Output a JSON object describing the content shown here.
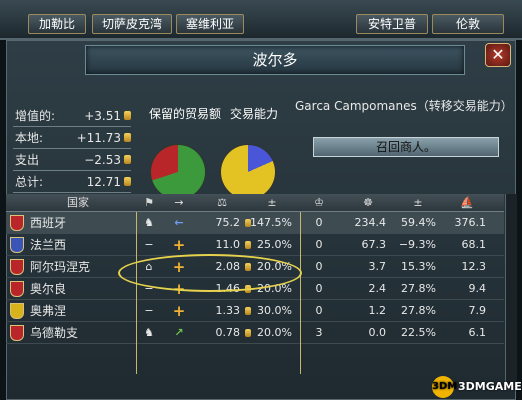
{
  "top_tabs": {
    "left": [
      "加勒比",
      "切萨皮克湾",
      "塞维利亚"
    ],
    "right": [
      "安特卫普",
      "伦敦"
    ]
  },
  "window": {
    "title": "波尔多",
    "close_label": "✕"
  },
  "stats": [
    {
      "label": "增值的:",
      "value": "+3.51"
    },
    {
      "label": "本地:",
      "value": "+11.73"
    },
    {
      "label": "支出",
      "value": "−2.53"
    },
    {
      "label": "总计:",
      "value": "12.71"
    }
  ],
  "pies": {
    "retained_label": "保留的贸易额",
    "power_label": "交易能力",
    "retained": {
      "green_share": 0.7,
      "red_share": 0.3
    },
    "power": {
      "blue_share": 0.183,
      "yellow_share": 0.817
    },
    "colors": {
      "green": "#3c9a3d",
      "red": "#b8262a",
      "blue": "#4a56d8",
      "yellow": "#e3c323"
    }
  },
  "merchant": {
    "name": "Garca Campomanes（转移交易能力）",
    "recall_button": "召回商人。"
  },
  "table": {
    "headers": [
      "国家",
      "⚑",
      "→",
      "⚖",
      "±",
      "♔",
      "☸",
      "±",
      "⛵"
    ],
    "rows": [
      {
        "name": "西班牙",
        "flag_color": "#b8262a",
        "icon": "merchant-icon",
        "dir": "←",
        "power": "75.2",
        "pct": "147.5%",
        "v1": "0",
        "v2": "234.4",
        "v3": "59.4%",
        "v4": "376.1"
      },
      {
        "name": "法兰西",
        "flag_color": "#3a55b8",
        "icon": "dash",
        "dir": "+",
        "power": "11.0",
        "pct": "25.0%",
        "v1": "0",
        "v2": "67.3",
        "v3": "−9.3%",
        "v4": "68.1"
      },
      {
        "name": "阿尔玛涅克",
        "flag_color": "#b8262a",
        "icon": "building-icon",
        "dir": "+",
        "power": "2.08",
        "pct": "20.0%",
        "v1": "0",
        "v2": "3.7",
        "v3": "15.3%",
        "v4": "12.3"
      },
      {
        "name": "奥尔良",
        "flag_color": "#b8262a",
        "icon": "dash",
        "dir": "+",
        "power": "1.46",
        "pct": "20.0%",
        "v1": "0",
        "v2": "2.4",
        "v3": "27.8%",
        "v4": "9.4"
      },
      {
        "name": "奥弗涅",
        "flag_color": "#d7b21b",
        "icon": "dash",
        "dir": "+",
        "power": "1.33",
        "pct": "30.0%",
        "v1": "0",
        "v2": "1.2",
        "v3": "27.8%",
        "v4": "7.9"
      },
      {
        "name": "乌德勒支",
        "flag_color": "#b8262a",
        "icon": "merchant-icon",
        "dir": "↗",
        "power": "0.78",
        "pct": "20.0%",
        "v1": "3",
        "v2": "0.0",
        "v3": "22.5%",
        "v4": "6.1"
      }
    ]
  },
  "watermark": {
    "circle": "3DM",
    "text": "3DMGAME"
  }
}
